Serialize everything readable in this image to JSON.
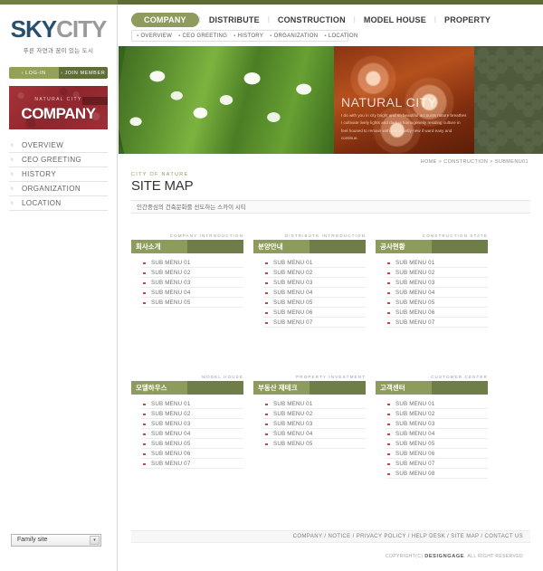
{
  "brand": {
    "logo_sky": "SKY",
    "logo_city": "CITY",
    "tagline": "푸른 자연과 꿈이 있는 도시"
  },
  "auth": {
    "login_label": "LOG-IN",
    "join_label": "JOIN MEMBER",
    "arrow": "›"
  },
  "page_banner": {
    "eyebrow": "NATURAL CITY",
    "title": "COMPANY"
  },
  "sidebar": {
    "items": [
      {
        "label": "OVERVIEW",
        "chevron": "›"
      },
      {
        "label": "CEO GREETING",
        "chevron": "›"
      },
      {
        "label": "HISTORY",
        "chevron": "›"
      },
      {
        "label": "ORGANIZATION",
        "chevron": "›"
      },
      {
        "label": "LOCATION",
        "chevron": "›"
      }
    ],
    "family_site": {
      "label": "Family site",
      "arrow": "▾"
    }
  },
  "gnb": {
    "items": [
      {
        "label": "COMPANY",
        "active": true
      },
      {
        "label": "DISTRIBUTE",
        "active": false
      },
      {
        "label": "CONSTRUCTION",
        "active": false
      },
      {
        "label": "MODEL HOUSE",
        "active": false
      },
      {
        "label": "PROPERTY",
        "active": false
      }
    ],
    "separator": "|"
  },
  "lnb": {
    "items": [
      {
        "label": "OVERVIEW",
        "dot": "▪"
      },
      {
        "label": "CEO GREETING",
        "dot": "▪"
      },
      {
        "label": "HISTORY",
        "dot": "▪"
      },
      {
        "label": "ORGANIZATION",
        "dot": "▪"
      },
      {
        "label": "LOCATION",
        "dot": "▪"
      }
    ]
  },
  "hero": {
    "title": "NATURAL CITY",
    "body": "I do with you in city bright and so beautiful accounts nature breathes I cultivate lively lights and dark is homogeneity residing culture in feel housed to remain with many justly new if ward easy and continue."
  },
  "page_head": {
    "breadcrumb": "HOME > CONSTRUCTION > SUBMENU01",
    "eyebrow": "CITY OF NATURE",
    "title": "SITE MAP",
    "description": "인간중심의 건축문화를 선도하는 스카이 시티"
  },
  "sitemap": {
    "rows": [
      [
        {
          "eyebrow": "COMPANY INTRODUCTION",
          "title": "회사소개",
          "items": [
            "SUB MENU 01",
            "SUB MENU 02",
            "SUB MENU 03",
            "SUB MENU 04",
            "SUB MENU 05"
          ]
        },
        {
          "eyebrow": "DISTRIBUTE INTRODUCTION",
          "title": "분양안내",
          "items": [
            "SUB MENU 01",
            "SUB MENU 02",
            "SUB MENU 03",
            "SUB MENU 04",
            "SUB MENU 05",
            "SUB MENU 06",
            "SUB MENU 07"
          ]
        },
        {
          "eyebrow": "CONSTRUCTION STATE",
          "title": "공사현황",
          "items": [
            "SUB MENU 01",
            "SUB MENU 02",
            "SUB MENU 03",
            "SUB MENU 04",
            "SUB MENU 05",
            "SUB MENU 06",
            "SUB MENU 07"
          ]
        }
      ],
      [
        {
          "eyebrow": "MODEL HOUSE",
          "title": "모델하우스",
          "items": [
            "SUB MENU 01",
            "SUB MENU 02",
            "SUB MENU 03",
            "SUB MENU 04",
            "SUB MENU 05",
            "SUB MENU 06",
            "SUB MENU 07"
          ]
        },
        {
          "eyebrow": "PROPERTY INVESTMENT",
          "title": "부동산 재테크",
          "items": [
            "SUB MENU 01",
            "SUB MENU 02",
            "SUB MENU 03",
            "SUB MENU 04",
            "SUB MENU 05"
          ]
        },
        {
          "eyebrow": "CUSTOMER CENTER",
          "title": "고객센터",
          "items": [
            "SUB MENU 01",
            "SUB MENU 02",
            "SUB MENU 03",
            "SUB MENU 04",
            "SUB MENU 05",
            "SUB MENU 06",
            "SUB MENU 07",
            "SUB MENU 08"
          ]
        }
      ]
    ]
  },
  "footer": {
    "links": "COMPANY / NOTICE / PRIVACY POLICY / HELP DESK / SITE MAP / CONTACT US",
    "copyright_pre": "COPYRIGHT(C) ",
    "copyright_brand": "DESIGNGAGE",
    "copyright_post": ". ALL RIGHT RESERVED"
  },
  "colors": {
    "olive_light": "#8d9b5c",
    "olive_dark": "#6f7e48",
    "banner_red": "#a6333a",
    "logo_blue": "#27506e",
    "bullet_red": "#b84a4a"
  }
}
